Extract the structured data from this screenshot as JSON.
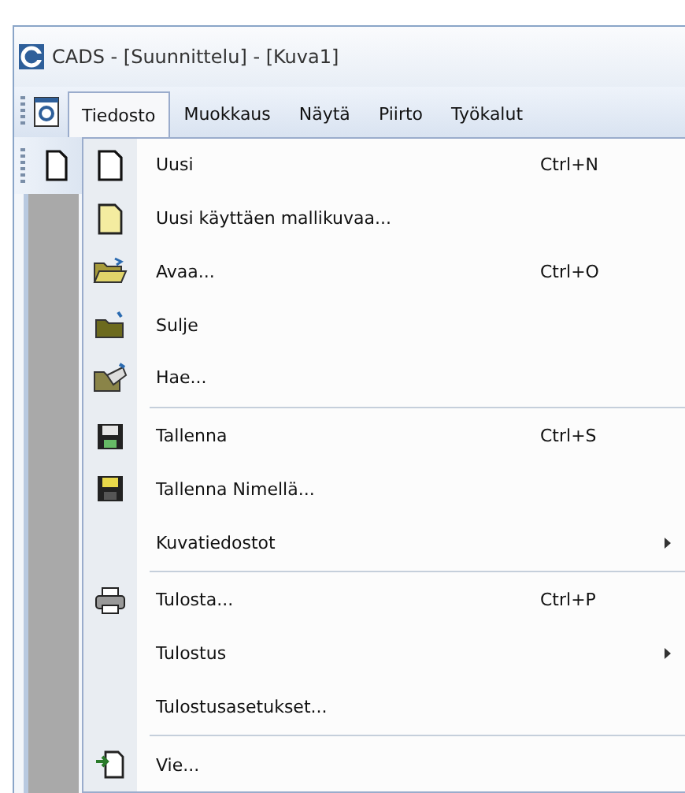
{
  "window": {
    "title": "CADS - [Suunnittelu] - [Kuva1]"
  },
  "menubar": [
    {
      "label": "Tiedosto",
      "selected": true
    },
    {
      "label": "Muokkaus",
      "selected": false
    },
    {
      "label": "Näytä",
      "selected": false
    },
    {
      "label": "Piirto",
      "selected": false
    },
    {
      "label": "Työkalut",
      "selected": false
    }
  ],
  "menu": [
    {
      "kind": "item",
      "label": "Uusi",
      "shortcut": "Ctrl+N"
    },
    {
      "kind": "item",
      "label": "Uusi käyttäen mallikuvaa..."
    },
    {
      "kind": "item",
      "label": "Avaa...",
      "shortcut": "Ctrl+O"
    },
    {
      "kind": "item",
      "label": "Sulje"
    },
    {
      "kind": "item",
      "label": "Hae..."
    },
    {
      "kind": "separator"
    },
    {
      "kind": "item",
      "label": "Tallenna",
      "shortcut": "Ctrl+S"
    },
    {
      "kind": "item",
      "label": "Tallenna Nimellä..."
    },
    {
      "kind": "item",
      "label": "Kuvatiedostot",
      "submenu": true
    },
    {
      "kind": "separator"
    },
    {
      "kind": "item",
      "label": "Tulosta...",
      "shortcut": "Ctrl+P"
    },
    {
      "kind": "item",
      "label": "Tulostus",
      "submenu": true
    },
    {
      "kind": "item",
      "label": "Tulostusasetukset..."
    },
    {
      "kind": "separator"
    },
    {
      "kind": "item",
      "label": "Vie..."
    }
  ]
}
